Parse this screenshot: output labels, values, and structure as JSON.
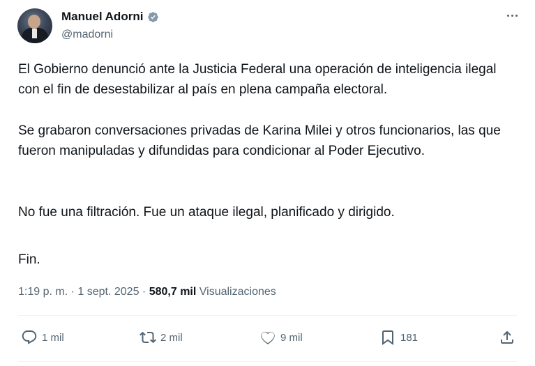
{
  "author": {
    "name": "Manuel Adorni",
    "handle": "@madorni"
  },
  "tweet": {
    "paragraphs": [
      "El Gobierno denunció ante la Justicia Federal una operación de inteligencia ilegal con el fin de desestabilizar al país en plena campaña electoral.",
      "Se grabaron conversaciones privadas de Karina Milei y otros funcionarios, las que fueron manipuladas y difundidas para condicionar al Poder Ejecutivo.",
      "No fue una filtración. Fue un ataque ilegal, planificado y dirigido.",
      "Fin."
    ],
    "time": "1:19 p. m.",
    "separator": "·",
    "date": "1 sept. 2025",
    "views_count": "580,7 mil",
    "views_label": "Visualizaciones"
  },
  "actions": {
    "replies": "1 mil",
    "retweets": "2 mil",
    "likes": "9 mil",
    "bookmarks": "181"
  },
  "icons": {
    "verified": "verified-badge-icon",
    "more": "more-options-icon",
    "reply": "reply-icon",
    "retweet": "retweet-icon",
    "like": "heart-icon",
    "bookmark": "bookmark-icon",
    "share": "share-icon"
  },
  "colors": {
    "text": "#0f1419",
    "secondary": "#536471",
    "verified": "#829aab"
  }
}
